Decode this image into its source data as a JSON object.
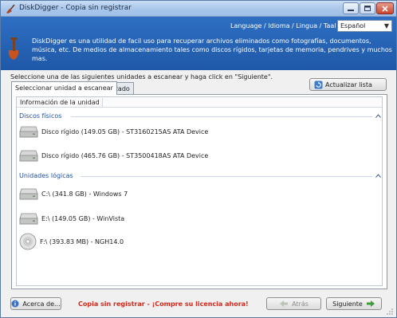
{
  "window": {
    "title": "DiskDigger - Copia sin registrar"
  },
  "header": {
    "language_label": "Language / Idioma / Lingua / Taal / Язык",
    "language_value": "Español",
    "description": "DiskDigger es una utilidad de facil uso para recuperar archivos eliminados como fotografías, documentos, música, etc. De medios de almacenamiento tales como discos rígidos, tarjetas de memoria, pendrives y muchos mas."
  },
  "main": {
    "instruction": "Seleccione una de las siguientes unidades a escanear y haga click en \"Siguiente\".",
    "refresh_label": "Actualizar lista",
    "tabs": [
      {
        "label": "Seleccionar unidad a escanear"
      },
      {
        "label": "Avanzado"
      }
    ],
    "column_header": "Información de la unidad",
    "groups": [
      {
        "label": "Discos físicos",
        "items": [
          {
            "label": "Disco rígido (149.05 GB) - ST3160215AS ATA Device",
            "icon": "hard-disk-icon"
          },
          {
            "label": "Disco rígido (465.76 GB) - ST3500418AS ATA Device",
            "icon": "hard-disk-icon"
          }
        ]
      },
      {
        "label": "Unidades lógicas",
        "items": [
          {
            "label": "C:\\ (341.8 GB) - Windows 7",
            "icon": "drive-icon"
          },
          {
            "label": "E:\\ (149.05 GB) - WinVista",
            "icon": "drive-icon"
          },
          {
            "label": "F:\\ (393.83 MB) - NGH14.0",
            "icon": "cd-icon"
          }
        ]
      }
    ]
  },
  "footer": {
    "about_label": "Acerca de...",
    "promo": "Copia sin registrar - ¡Compre su licencia ahora!",
    "back_label": "Atrás",
    "next_label": "Siguiente"
  },
  "colors": {
    "header_bg": "#2466b8",
    "group_text": "#1f4fa3",
    "promo_text": "#d8271b"
  }
}
